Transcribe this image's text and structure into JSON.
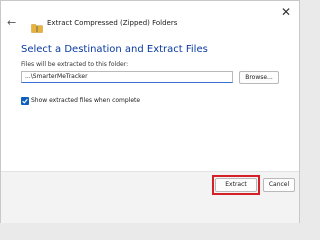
{
  "window": {
    "close_glyph": "✕",
    "back_glyph": "←",
    "title": "Extract Compressed (Zipped) Folders"
  },
  "main": {
    "heading": "Select a Destination and Extract Files",
    "field_label": "Files will be extracted to this folder:",
    "path_value": "...\\SmarterMeTracker",
    "browse_label": "Browse...",
    "checkbox_label": "Show extracted files when complete",
    "checkbox_checked": true
  },
  "footer": {
    "extract_label": "Extract",
    "cancel_label": "Cancel"
  },
  "colors": {
    "heading": "#0a3aa0",
    "checkbox": "#0e5fbc",
    "highlight": "#d32127",
    "folder": "#e8b33a"
  },
  "icons": {
    "close": "close-icon",
    "back": "back-arrow-icon",
    "folder": "zip-folder-icon",
    "check": "checkmark-icon"
  }
}
